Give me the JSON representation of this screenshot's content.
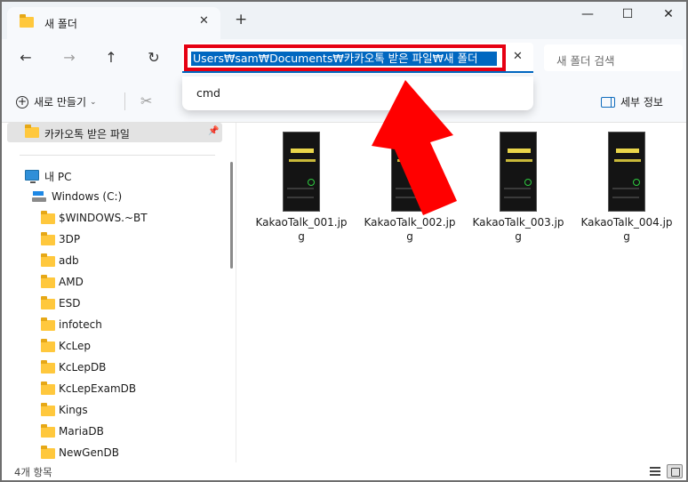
{
  "window": {
    "tab_title": "새 폴더",
    "tab_close": "✕",
    "new_tab": "+",
    "minimize": "—",
    "maximize": "☐",
    "close": "✕"
  },
  "nav": {
    "back": "←",
    "forward": "→",
    "up": "↑",
    "refresh": "↻",
    "address_path": "Users₩sam₩Documents₩카카오톡 받은 파일₩새 폴더",
    "address_clear": "✕",
    "search_placeholder": "새 폴더 검색"
  },
  "address_suggestions": [
    "cmd"
  ],
  "commandbar": {
    "new_label": "새로 만들기",
    "new_caret": "⌄",
    "cut_icon": "✂",
    "details_label": "세부 정보"
  },
  "sidebar": {
    "quick_access_item": "카카오톡 받은 파일",
    "pin": "📌",
    "this_pc": "내 PC",
    "drive": "Windows (C:)",
    "folders": [
      "$WINDOWS.~BT",
      "3DP",
      "adb",
      "AMD",
      "ESD",
      "infotech",
      "KcLep",
      "KcLepDB",
      "KcLepExamDB",
      "Kings",
      "MariaDB",
      "NewGenDB"
    ]
  },
  "files": [
    {
      "name": "KakaoTalk_001.jpg"
    },
    {
      "name": "KakaoTalk_002.jpg"
    },
    {
      "name": "KakaoTalk_003.jpg"
    },
    {
      "name": "KakaoTalk_004.jpg"
    }
  ],
  "status": {
    "item_count": "4개 항목"
  },
  "colors": {
    "highlight_border": "#e60012",
    "selection": "#0067c0",
    "arrow": "#ff0000",
    "folder": "#ffc83d"
  },
  "annotation": {
    "arrow_icon": "red-arrow-pointing-to-address-bar"
  }
}
